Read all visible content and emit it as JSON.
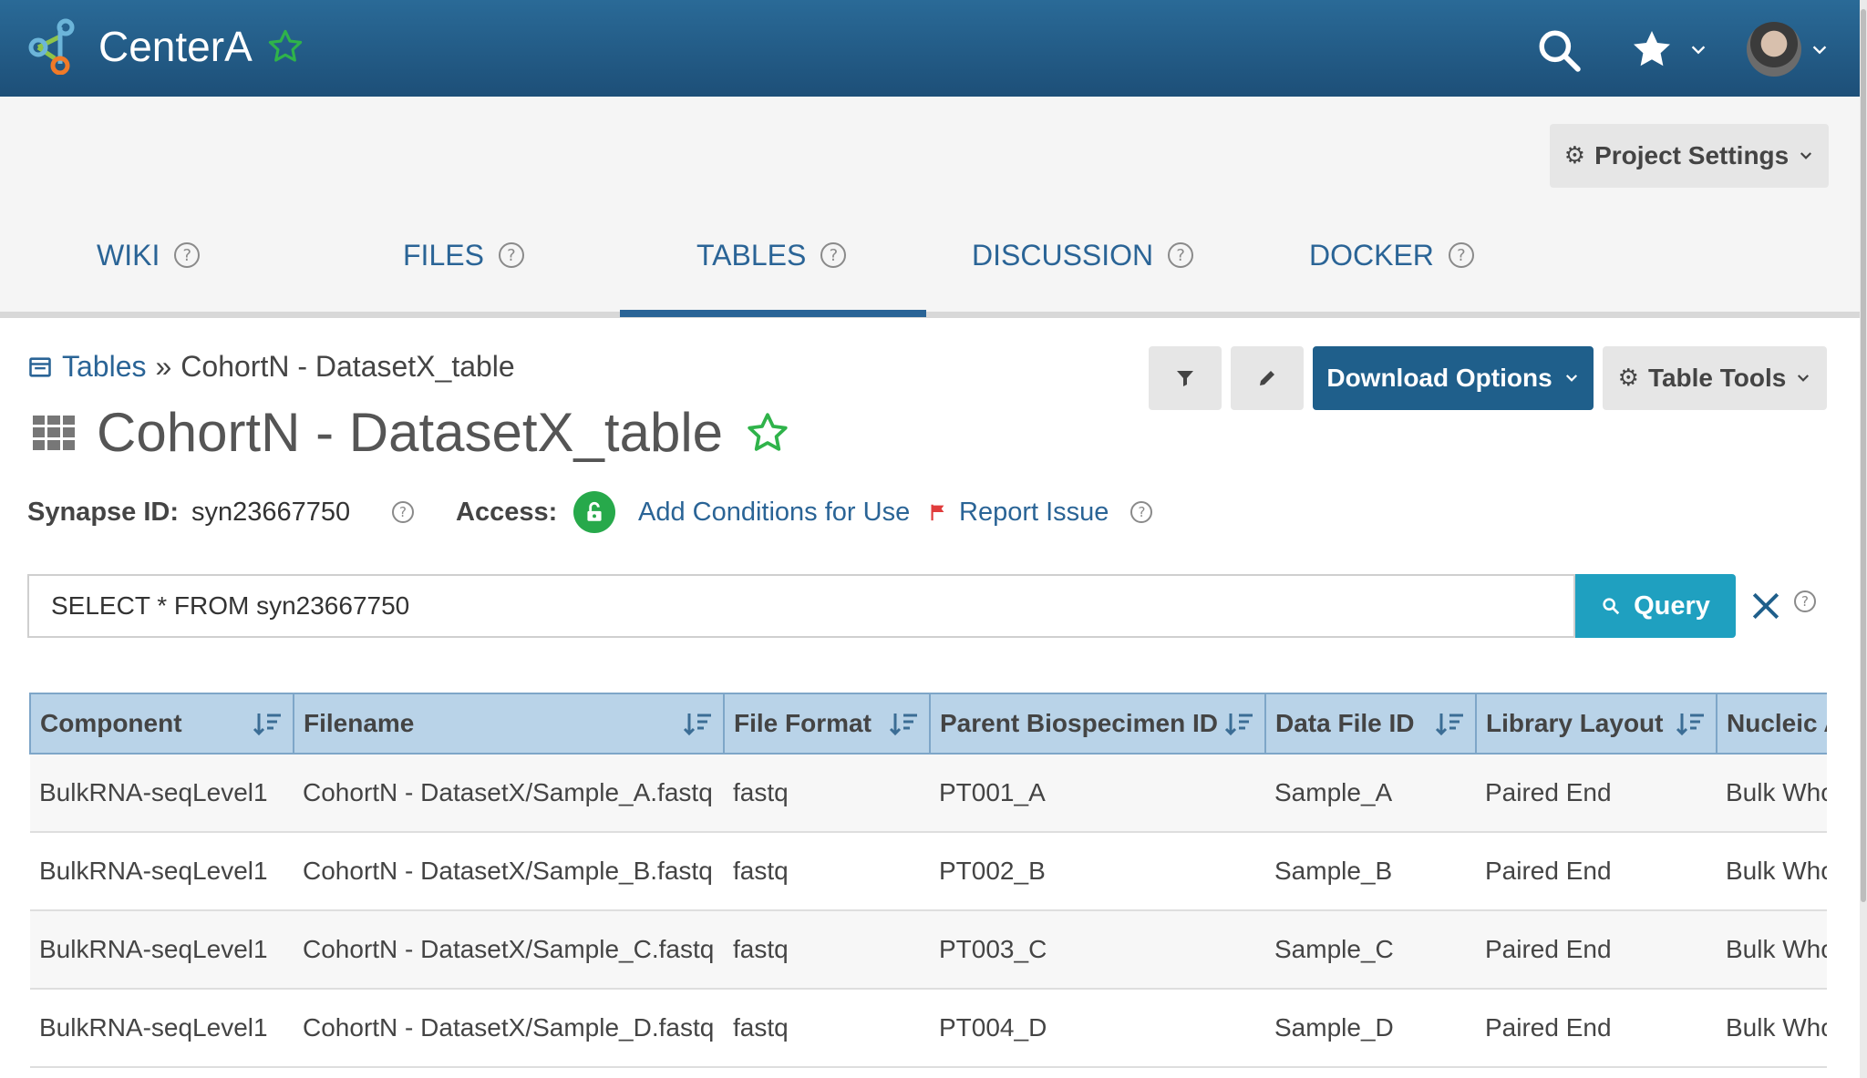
{
  "header": {
    "brand": "CenterA",
    "icons": [
      "logo-icon",
      "favorite-star-icon",
      "search-icon",
      "star-icon",
      "chevron-down-icon",
      "avatar"
    ],
    "colors": {
      "bar": "#1d4f78",
      "star_outline": "#2fb34a"
    }
  },
  "project_settings": {
    "label": "Project Settings"
  },
  "tabs": [
    {
      "label": "WIKI"
    },
    {
      "label": "FILES"
    },
    {
      "label": "TABLES",
      "active": true
    },
    {
      "label": "DISCUSSION"
    },
    {
      "label": "DOCKER"
    }
  ],
  "breadcrumb": {
    "root": "Tables",
    "separator": "»",
    "current": "CohortN - DatasetX_table"
  },
  "title": "CohortN - DatasetX_table",
  "toolbar": {
    "download_label": "Download Options",
    "tools_label": "Table Tools"
  },
  "meta": {
    "synapse_id_label": "Synapse ID:",
    "synapse_id": "syn23667750",
    "access_label": "Access:",
    "add_conditions": "Add Conditions for Use",
    "report_issue": "Report Issue"
  },
  "query": {
    "text": "SELECT * FROM syn23667750",
    "button_label": "Query",
    "accent": "#1fa0c0"
  },
  "table": {
    "columns": [
      "Component",
      "Filename",
      "File Format",
      "Parent Biospecimen ID",
      "Data File ID",
      "Library Layout",
      "Nucleic A"
    ],
    "rows": [
      [
        "BulkRNA-seqLevel1",
        "CohortN - DatasetX/Sample_A.fastq",
        "fastq",
        "PT001_A",
        "Sample_A",
        "Paired End",
        "Bulk Who"
      ],
      [
        "BulkRNA-seqLevel1",
        "CohortN - DatasetX/Sample_B.fastq",
        "fastq",
        "PT002_B",
        "Sample_B",
        "Paired End",
        "Bulk Who"
      ],
      [
        "BulkRNA-seqLevel1",
        "CohortN - DatasetX/Sample_C.fastq",
        "fastq",
        "PT003_C",
        "Sample_C",
        "Paired End",
        "Bulk Who"
      ],
      [
        "BulkRNA-seqLevel1",
        "CohortN - DatasetX/Sample_D.fastq",
        "fastq",
        "PT004_D",
        "Sample_D",
        "Paired End",
        "Bulk Who"
      ]
    ]
  }
}
